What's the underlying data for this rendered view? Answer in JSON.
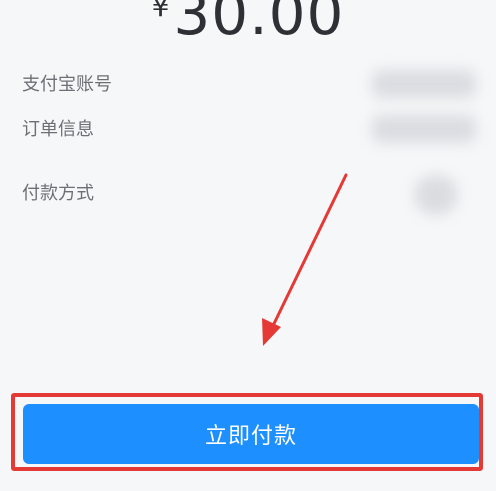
{
  "payment": {
    "currency_symbol": "¥",
    "amount": "30.00"
  },
  "details": {
    "account_label": "支付宝账号",
    "order_label": "订单信息",
    "method_label": "付款方式"
  },
  "action": {
    "pay_label": "立即付款"
  },
  "colors": {
    "pay_button": "#1e8fff",
    "annotation_red": "#e53935"
  }
}
